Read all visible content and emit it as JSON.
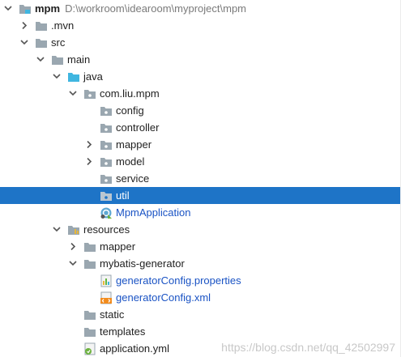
{
  "project_tree": {
    "root": {
      "label": "mpm",
      "path": "D:\\workroom\\idearoom\\myproject\\mpm",
      "icon": "module-folder-icon",
      "state": "expanded"
    },
    "mvn": {
      "label": ".mvn",
      "icon": "folder-icon",
      "state": "collapsed"
    },
    "src": {
      "label": "src",
      "icon": "folder-icon",
      "state": "expanded"
    },
    "main": {
      "label": "main",
      "icon": "folder-icon",
      "state": "expanded"
    },
    "java": {
      "label": "java",
      "icon": "source-root-folder-icon",
      "state": "expanded"
    },
    "package": {
      "label": "com.liu.mpm",
      "icon": "package-icon",
      "state": "expanded"
    },
    "config": {
      "label": "config",
      "icon": "package-icon"
    },
    "controller": {
      "label": "controller",
      "icon": "package-icon"
    },
    "mapper_pkg": {
      "label": "mapper",
      "icon": "package-icon",
      "state": "collapsed"
    },
    "model": {
      "label": "model",
      "icon": "package-icon",
      "state": "collapsed"
    },
    "service": {
      "label": "service",
      "icon": "package-icon"
    },
    "util": {
      "label": "util",
      "icon": "package-icon",
      "selected": true
    },
    "app_class": {
      "label": "MpmApplication",
      "icon": "spring-boot-class-icon"
    },
    "resources": {
      "label": "resources",
      "icon": "resources-root-folder-icon",
      "state": "expanded"
    },
    "mapper_res": {
      "label": "mapper",
      "icon": "folder-icon",
      "state": "collapsed"
    },
    "mybatis_gen": {
      "label": "mybatis-generator",
      "icon": "folder-icon",
      "state": "expanded"
    },
    "gen_props": {
      "label": "generatorConfig.properties",
      "icon": "properties-file-icon"
    },
    "gen_xml": {
      "label": "generatorConfig.xml",
      "icon": "xml-file-icon"
    },
    "static_dir": {
      "label": "static",
      "icon": "folder-icon"
    },
    "templates_dir": {
      "label": "templates",
      "icon": "folder-icon"
    },
    "app_yml": {
      "label": "application.yml",
      "icon": "yaml-file-icon"
    }
  },
  "watermark": "https://blog.csdn.net/qq_42502997",
  "colors": {
    "selection": "#1e74c7",
    "link_blue": "#1a53c4",
    "folder_gray": "#9aa7b0",
    "source_root_blue": "#40b6e0"
  }
}
